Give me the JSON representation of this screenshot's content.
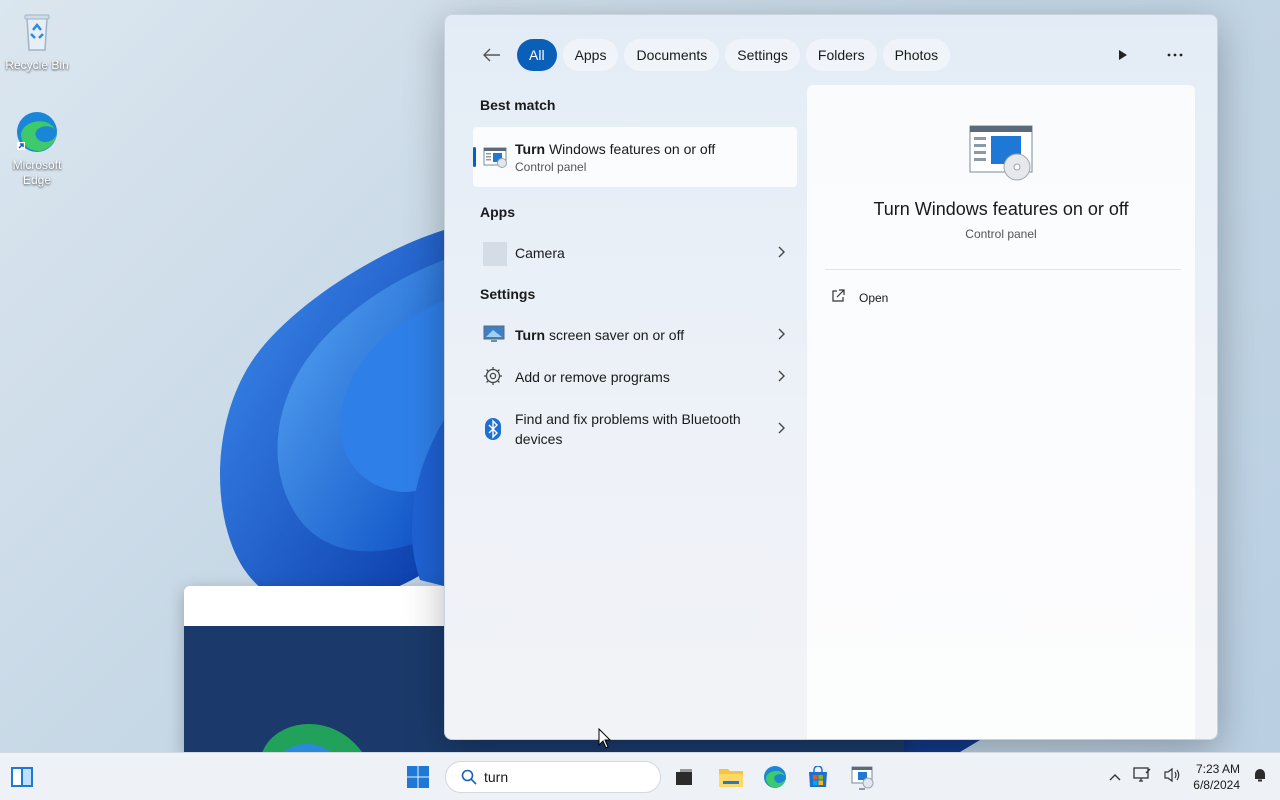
{
  "desktop": {
    "icons": [
      {
        "label": "Recycle Bin",
        "icon": "recycle-bin-icon"
      },
      {
        "label": "Microsoft Edge",
        "icon": "edge-icon"
      }
    ]
  },
  "search_panel": {
    "tabs": [
      "All",
      "Apps",
      "Documents",
      "Settings",
      "Folders",
      "Photos"
    ],
    "active_tab": "All",
    "sections": {
      "best_match": "Best match",
      "apps": "Apps",
      "settings": "Settings"
    },
    "best_match": {
      "title_highlight": "Turn",
      "title_rest": " Windows features on or off",
      "subtitle": "Control panel"
    },
    "apps": [
      {
        "label": "Camera"
      }
    ],
    "settings": [
      {
        "label_highlight": "Turn",
        "label_rest": " screen saver on or off",
        "icon": "screensaver-icon"
      },
      {
        "label_highlight": "",
        "label_rest": "Add or remove programs",
        "icon": "gear-icon"
      },
      {
        "label_highlight": "",
        "label_rest": "Find and fix problems with Bluetooth devices",
        "icon": "bluetooth-icon"
      }
    ],
    "preview": {
      "title": "Turn Windows features on or off",
      "subtitle": "Control panel",
      "action": "Open"
    }
  },
  "taskbar": {
    "search_value": "turn",
    "clock": {
      "time": "7:23 AM",
      "date": "6/8/2024"
    }
  },
  "colors": {
    "accent": "#0a5fb8",
    "taskbar": "#eef1f5"
  }
}
